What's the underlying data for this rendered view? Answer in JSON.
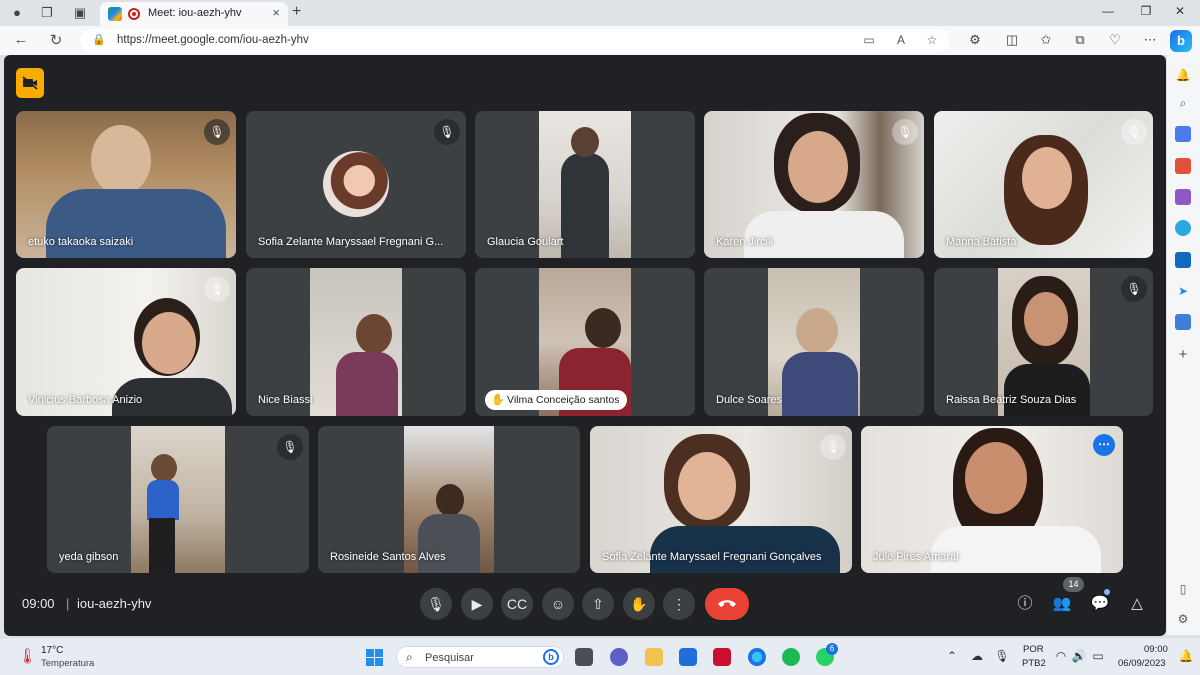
{
  "browser": {
    "tab_title": "Meet: iou-aezh-yhv",
    "url": "https://meet.google.com/iou-aezh-yhv",
    "tab_close": "×",
    "new_tab": "+"
  },
  "meeting": {
    "time": "09:00",
    "separator": "|",
    "code": "iou-aezh-yhv",
    "participant_count": "14"
  },
  "participants": [
    {
      "name": "etuko takaoka saizaki",
      "muted": true
    },
    {
      "name": "Sofia Zelante Maryssael Fregnani G...",
      "muted": true
    },
    {
      "name": "Glaucia Goulart",
      "muted": false
    },
    {
      "name": "Karen Jircik",
      "muted": true
    },
    {
      "name": "Marina Batista",
      "muted": true
    },
    {
      "name": "Vinicius Barbosa Anizio",
      "muted": true
    },
    {
      "name": "Nice Biassi",
      "muted": false
    },
    {
      "name": "Vilma Conceição santos",
      "muted": false,
      "hand_raised": true
    },
    {
      "name": "Dulce Soares",
      "muted": false
    },
    {
      "name": "Raissa Beatriz Souza Dias",
      "muted": true
    },
    {
      "name": "yeda gibson",
      "muted": true
    },
    {
      "name": "Rosineide Santos Alves",
      "muted": false
    },
    {
      "name": "Sofia Zelante Maryssael Fregnani Gonçalves",
      "muted": true
    },
    {
      "name": "Jule Pires Amaral",
      "muted": false,
      "speaking": true
    }
  ],
  "taskbar": {
    "temperature": "17°C",
    "weather_label": "Temperatura",
    "search_placeholder": "Pesquisar",
    "language_1": "POR",
    "language_2": "PTB2",
    "clock_time": "09:00",
    "clock_date": "06/09/2023",
    "whatsapp_badge": "6"
  },
  "colors": {
    "meet_background": "#202124",
    "tile_background": "#3c4043",
    "end_call": "#ea4335",
    "active_speaker_outline": "#8ab4f8",
    "camera_badge": "#f9ab00"
  }
}
